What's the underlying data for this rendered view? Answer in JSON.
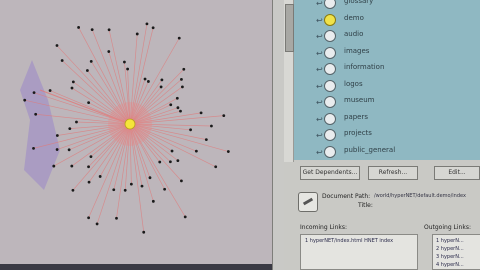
{
  "visualization": {
    "hub_color": "#f5e53a",
    "edge_color": "#e07a7a",
    "node_color": "#1a1a1a"
  },
  "tree_list": {
    "items": [
      {
        "label": "glossary",
        "highlighted": false
      },
      {
        "label": "demo",
        "highlighted": true
      },
      {
        "label": "audio",
        "highlighted": false
      },
      {
        "label": "images",
        "highlighted": false
      },
      {
        "label": "information",
        "highlighted": false
      },
      {
        "label": "logos",
        "highlighted": false
      },
      {
        "label": "museum",
        "highlighted": false
      },
      {
        "label": "papers",
        "highlighted": false
      },
      {
        "label": "projects",
        "highlighted": false
      },
      {
        "label": "public_general",
        "highlighted": false
      }
    ],
    "back_glyph": "↩"
  },
  "buttons": {
    "get_dependents": "Get Dependents...",
    "refresh": "Refresh...",
    "edit": "Edit..."
  },
  "document": {
    "path_label": "Document Path:",
    "path_value": "/world/hyperNET/default.demo/index",
    "title_label": "Title:"
  },
  "links": {
    "incoming_label": "Incoming Links:",
    "outgoing_label": "Outgoing Links:",
    "incoming_items": [
      "1   hyperNET/index.html HNET index"
    ],
    "outgoing_items": [
      "1   hyperN...",
      "2   hyperN...",
      "3   hyperN...",
      "4   hyperN..."
    ]
  }
}
